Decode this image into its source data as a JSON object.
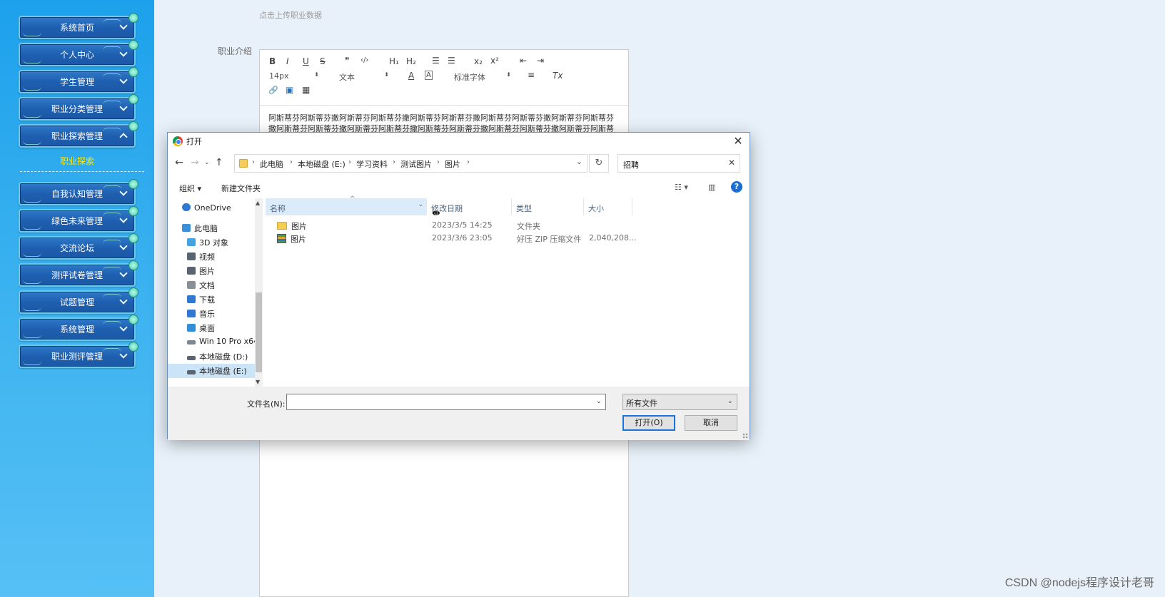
{
  "sidebar": {
    "items": [
      {
        "label": "系统首页"
      },
      {
        "label": "个人中心"
      },
      {
        "label": "学生管理"
      },
      {
        "label": "职业分类管理"
      },
      {
        "label": "职业探索管理"
      },
      {
        "label": "自我认知管理"
      },
      {
        "label": "绿色未来管理"
      },
      {
        "label": "交流论坛"
      },
      {
        "label": "测评试卷管理"
      },
      {
        "label": "试题管理"
      },
      {
        "label": "系统管理"
      },
      {
        "label": "职业测评管理"
      }
    ],
    "sub_item": "职业探索"
  },
  "form": {
    "upload_hint": "点击上传职业数据",
    "intro_label": "职业介绍"
  },
  "editor": {
    "toolbar": {
      "bold": "B",
      "italic": "I",
      "underline": "U",
      "strike": "S",
      "blockquote": "❞",
      "code": "‹/›",
      "h1": "H₁",
      "h2": "H₂",
      "ordered_list": "☰",
      "bullet_list": "☰",
      "subscript": "x₂",
      "superscript": "x²",
      "outdent": "⇤",
      "indent": "⇥",
      "font_size": "14px",
      "paragraph": "文本",
      "font_color": "A",
      "bg_color": "A",
      "font_family": "标准字体",
      "align": "≡",
      "clear_format": "Tx",
      "link": "🔗",
      "image": "▣",
      "video": "▦"
    },
    "content": "阿斯蒂芬阿斯蒂芬撒阿斯蒂芬阿斯蒂芬撒阿斯蒂芬阿斯蒂芬撒阿斯蒂芬阿斯蒂芬撒阿斯蒂芬阿斯蒂芬撒阿斯蒂芬阿斯蒂芬撒阿斯蒂芬阿斯蒂芬撒阿斯蒂芬阿斯蒂芬撒阿斯蒂芬阿斯蒂芬撒阿斯蒂芬阿斯蒂芬"
  },
  "dialog": {
    "title": "打开",
    "close": "✕",
    "breadcrumbs": [
      "此电脑",
      "本地磁盘 (E:)",
      "学习资料",
      "测试图片",
      "图片"
    ],
    "search_value": "招聘",
    "commands": {
      "organize": "组织 ▾",
      "new_folder": "新建文件夹"
    },
    "nav_pane": [
      {
        "label": "OneDrive",
        "icon": "cloud-icon",
        "color": "#2f77d1"
      },
      {
        "label": "此电脑",
        "icon": "computer-icon",
        "color": "#3b8fd9"
      },
      {
        "label": "3D 对象",
        "icon": "cube-icon",
        "color": "#43a4e3"
      },
      {
        "label": "视频",
        "icon": "video-icon",
        "color": "#5a6470"
      },
      {
        "label": "图片",
        "icon": "pictures-icon",
        "color": "#5a6470"
      },
      {
        "label": "文档",
        "icon": "document-icon",
        "color": "#8a8f96"
      },
      {
        "label": "下载",
        "icon": "download-icon",
        "color": "#2f77d1"
      },
      {
        "label": "音乐",
        "icon": "music-icon",
        "color": "#2f77d1"
      },
      {
        "label": "桌面",
        "icon": "desktop-icon",
        "color": "#2f8fd9"
      },
      {
        "label": "Win 10 Pro x64",
        "icon": "drive-icon",
        "color": "#7d8794"
      },
      {
        "label": "本地磁盘 (D:)",
        "icon": "drive-icon",
        "color": "#5a6470"
      },
      {
        "label": "本地磁盘 (E:)",
        "icon": "drive-icon",
        "color": "#5a6470"
      }
    ],
    "columns": [
      "名称",
      "修改日期",
      "类型",
      "大小"
    ],
    "files": [
      {
        "name": "图片",
        "date": "2023/3/5 14:25",
        "type": "文件夹",
        "size": "",
        "icon": "folder-icon"
      },
      {
        "name": "图片",
        "date": "2023/3/6 23:05",
        "type": "好压 ZIP 压缩文件",
        "size": "2,040,208...",
        "icon": "zip-icon"
      }
    ],
    "filename_label": "文件名(N):",
    "filename_value": "",
    "filetype": "所有文件",
    "open_button": "打开(O)",
    "cancel_button": "取消"
  },
  "watermark": "CSDN @nodejs程序设计老哥"
}
